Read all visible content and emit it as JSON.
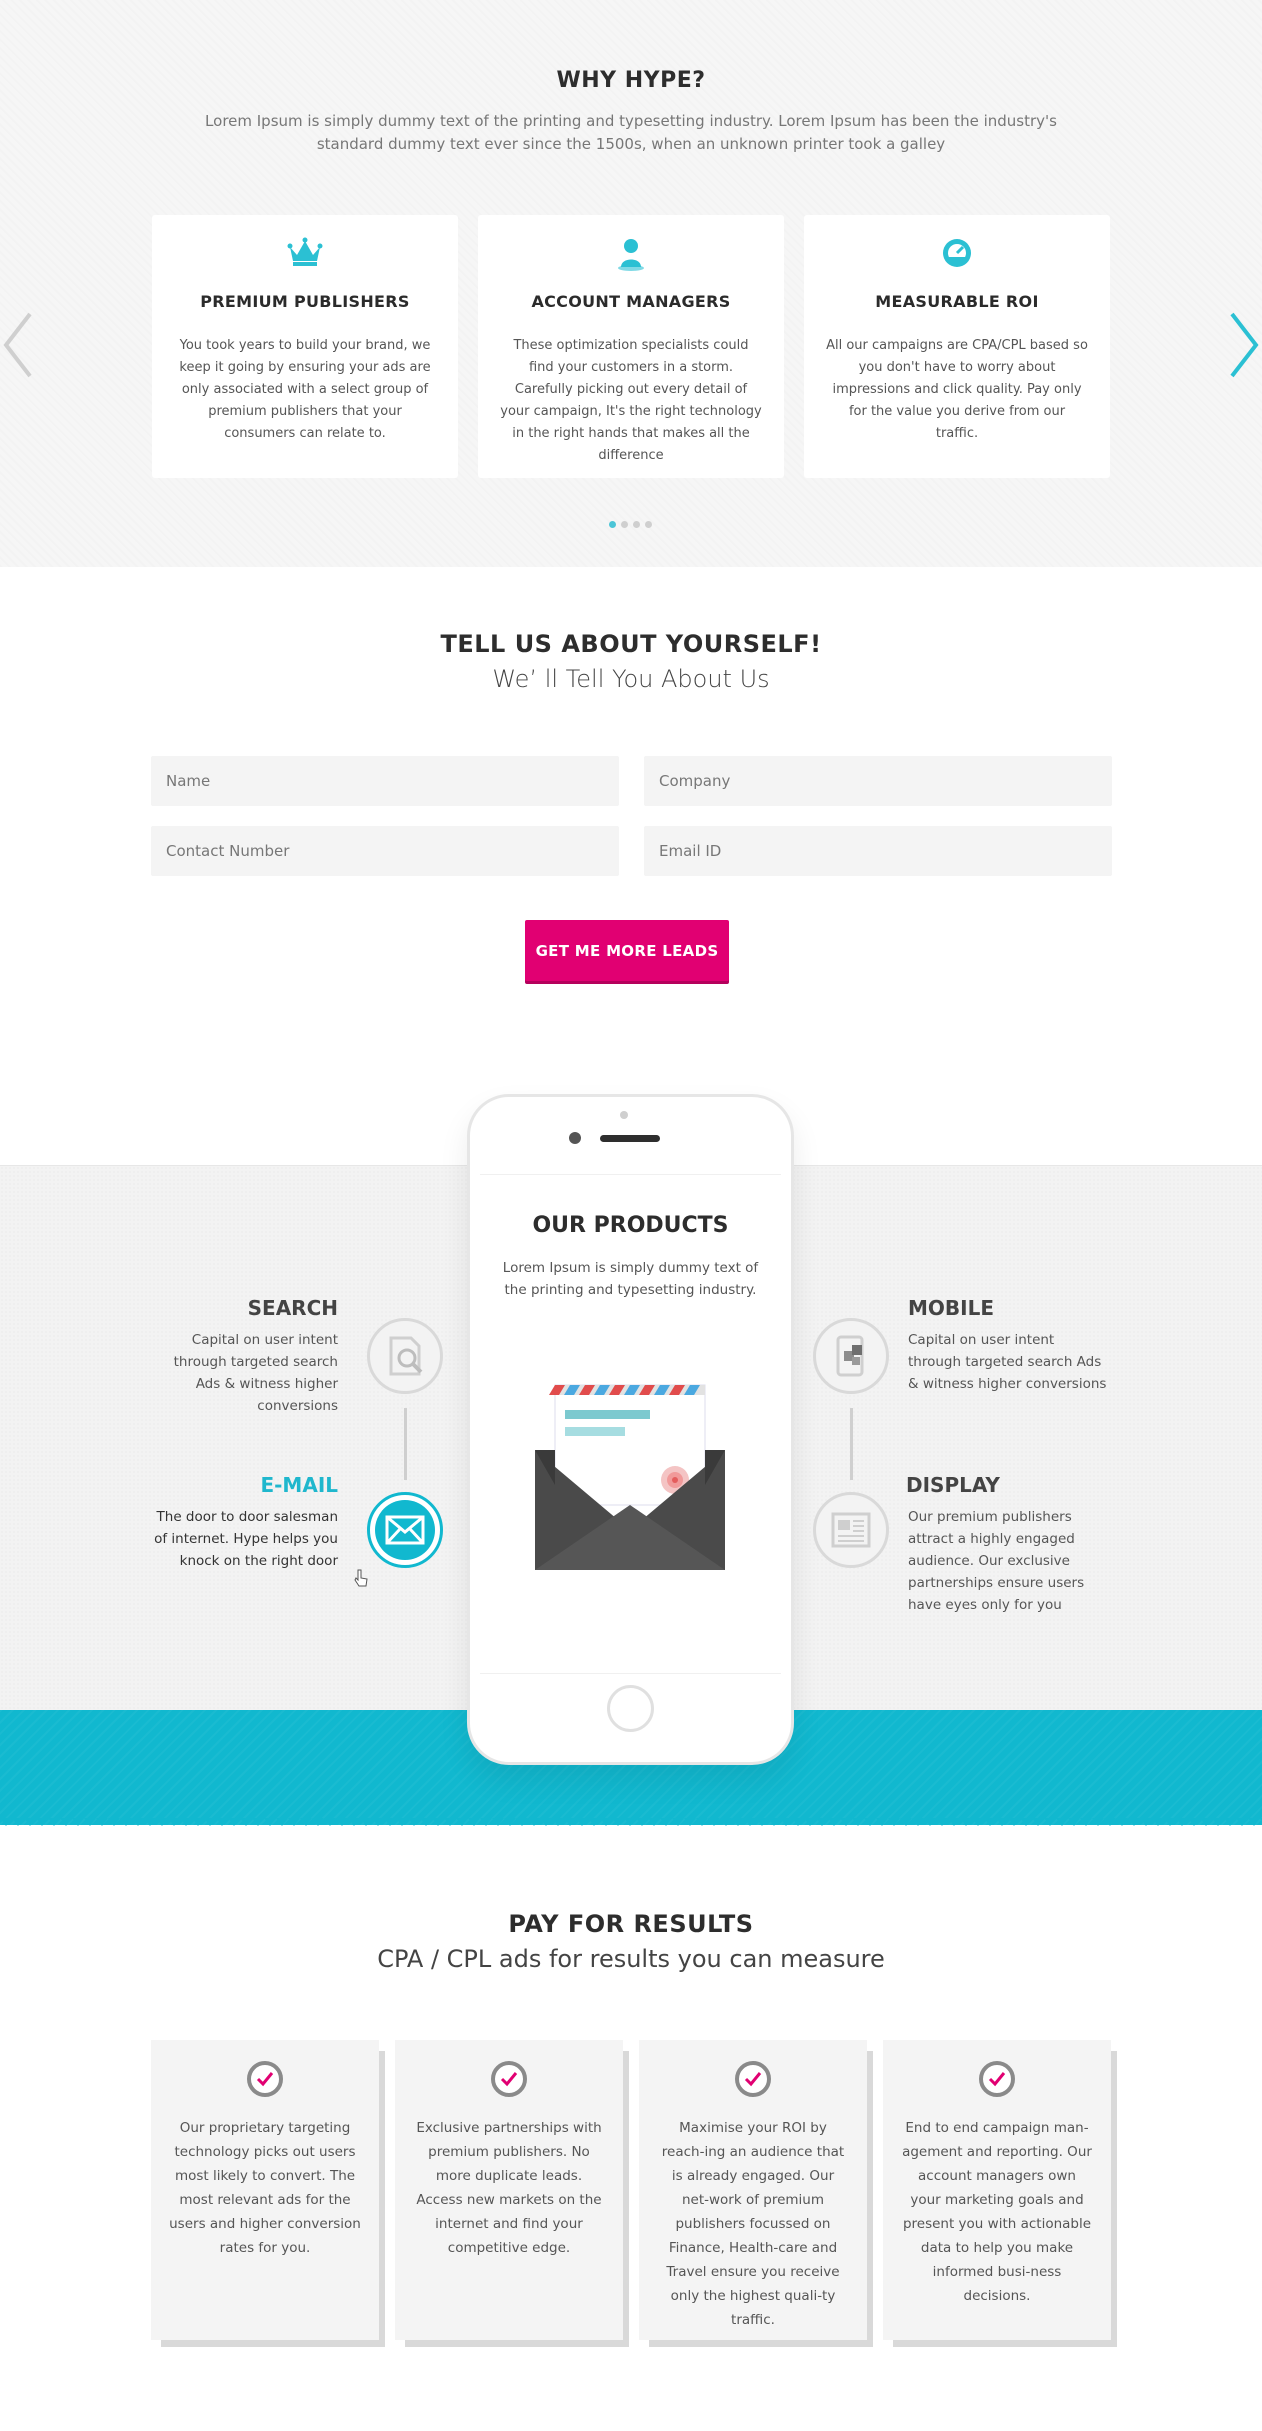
{
  "why": {
    "title": "WHY HYPE?",
    "intro": "Lorem Ipsum is simply dummy text of the printing and typesetting industry. Lorem Ipsum has been the industry's standard dummy text ever since the 1500s, when an unknown printer took a galley",
    "cards": [
      {
        "icon": "crown-icon",
        "title": "PREMIUM PUBLISHERS",
        "desc": "You took years to build your brand, we keep it going by ensuring your ads are only associated with a select group of premium publishers that your consumers can relate to."
      },
      {
        "icon": "person-pin-icon",
        "title": "ACCOUNT MANAGERS",
        "desc": "These optimization specialists could find your customers in a storm. Carefully picking out every detail of your campaign, It's the right technology in the right hands that makes all the difference"
      },
      {
        "icon": "gauge-icon",
        "title": "MEASURABLE ROI",
        "desc": "All our campaigns are CPA/CPL based so you don't have to worry about impressions and click quality. Pay only for the value you derive from our traffic."
      }
    ],
    "carousel": {
      "pages": 4,
      "active": 1
    },
    "accent": "#2bc0d3"
  },
  "tell": {
    "title": "TELL US ABOUT YOURSELF!",
    "subtitle": "We’ ll Tell You About Us",
    "fields": {
      "name": "Name",
      "company": "Company",
      "contact": "Contact Number",
      "email": "Email ID"
    },
    "button": "GET ME MORE LEADS",
    "button_color": "#e10072"
  },
  "products": {
    "title": "OUR PRODUCTS",
    "desc": "Lorem Ipsum is simply dummy text of the printing and typesetting industry.",
    "features": {
      "search": {
        "title": "SEARCH",
        "desc": "Capital on user intent through targeted search Ads & witness higher conversions",
        "icon": "search-doc-icon"
      },
      "email": {
        "title": "E-MAIL",
        "desc": "The door to door salesman of internet. Hype helps you knock on the right door",
        "icon": "envelope-icon"
      },
      "mobile": {
        "title": "MOBILE",
        "desc": "Capital on user intent through targeted search Ads & witness higher conversions",
        "icon": "mobile-icon"
      },
      "display": {
        "title": "DISPLAY",
        "desc": "Our premium publishers attract a highly engaged audience. Our exclusive partnerships ensure users have eyes only for you",
        "icon": "newspaper-icon"
      }
    },
    "teal": "#11b8cf"
  },
  "pay": {
    "title": "PAY FOR RESULTS",
    "subtitle": "CPA / CPL ads for results you can measure",
    "cards": [
      {
        "desc": "Our proprietary targeting technology picks out users most likely to convert. The most relevant ads for the users and higher conversion rates for you."
      },
      {
        "desc": "Exclusive partnerships with premium publishers. No more duplicate leads. Access new markets on the internet and find your competitive edge."
      },
      {
        "desc": "Maximise your ROI by reach-ing an audience that is already engaged. Our net-work of premium publishers focussed on Finance, Health-care and Travel ensure you receive only the highest quali-ty traffic."
      },
      {
        "desc": "End to end campaign man-agement and reporting. Our account managers own your marketing goals and present you with actionable data to help you make informed busi-ness decisions."
      }
    ],
    "check_color": "#e10072"
  }
}
